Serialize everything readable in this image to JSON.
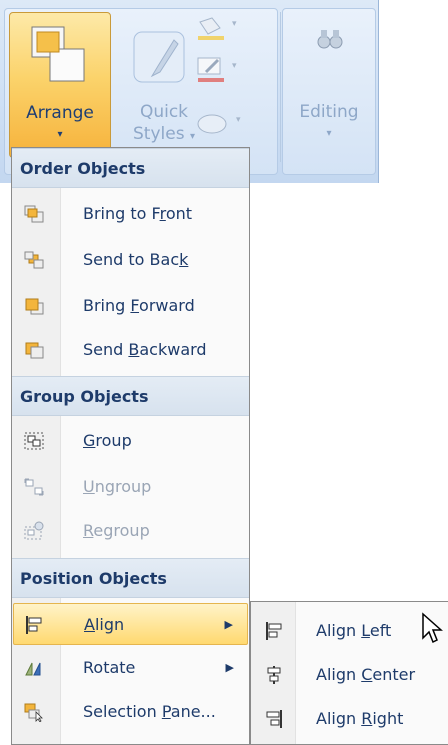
{
  "ribbon": {
    "arrange_label": "Arrange",
    "quick_styles_line1": "Quick",
    "quick_styles_line2": "Styles",
    "editing_label": "Editing",
    "dropdown_glyph": "▾"
  },
  "menu": {
    "sections": {
      "order": "Order Objects",
      "group": "Group Objects",
      "position": "Position Objects"
    },
    "items": {
      "bring_to_front": {
        "pre": "Bring to F",
        "key": "r",
        "post": "ont"
      },
      "send_to_back": {
        "pre": "Send to Bac",
        "key": "k",
        "post": ""
      },
      "bring_forward": {
        "pre": "Bring ",
        "key": "F",
        "post": "orward"
      },
      "send_backward": {
        "pre": "Send ",
        "key": "B",
        "post": "ackward"
      },
      "group": {
        "pre": "",
        "key": "G",
        "post": "roup"
      },
      "ungroup": {
        "pre": "",
        "key": "U",
        "post": "ngroup"
      },
      "regroup": {
        "pre": "",
        "key": "R",
        "post": "egroup"
      },
      "align": {
        "pre": "",
        "key": "A",
        "post": "lign"
      },
      "rotate": {
        "pre": "Rotate",
        "key": "",
        "post": ""
      },
      "selection_pane": {
        "pre": "Selection ",
        "key": "P",
        "post": "ane..."
      }
    },
    "submenu_arrow": "▶"
  },
  "submenu": {
    "align_left": {
      "pre": "Align ",
      "key": "L",
      "post": "eft"
    },
    "align_center": {
      "pre": "Align ",
      "key": "C",
      "post": "enter"
    },
    "align_right": {
      "pre": "Align ",
      "key": "R",
      "post": "ight"
    }
  },
  "colors": {
    "accent_highlight": "#ffd970",
    "menu_text": "#1e3b6a",
    "disabled_text": "#9aa5b5",
    "ribbon_bg": "#cfe0f5"
  },
  "icons": {
    "arrange": "arrange-icon",
    "quick_styles": "quick-styles-icon",
    "find": "binoculars-icon",
    "fill": "paint-bucket-icon",
    "outline": "pen-outline-icon",
    "effects": "shape-effects-icon"
  }
}
